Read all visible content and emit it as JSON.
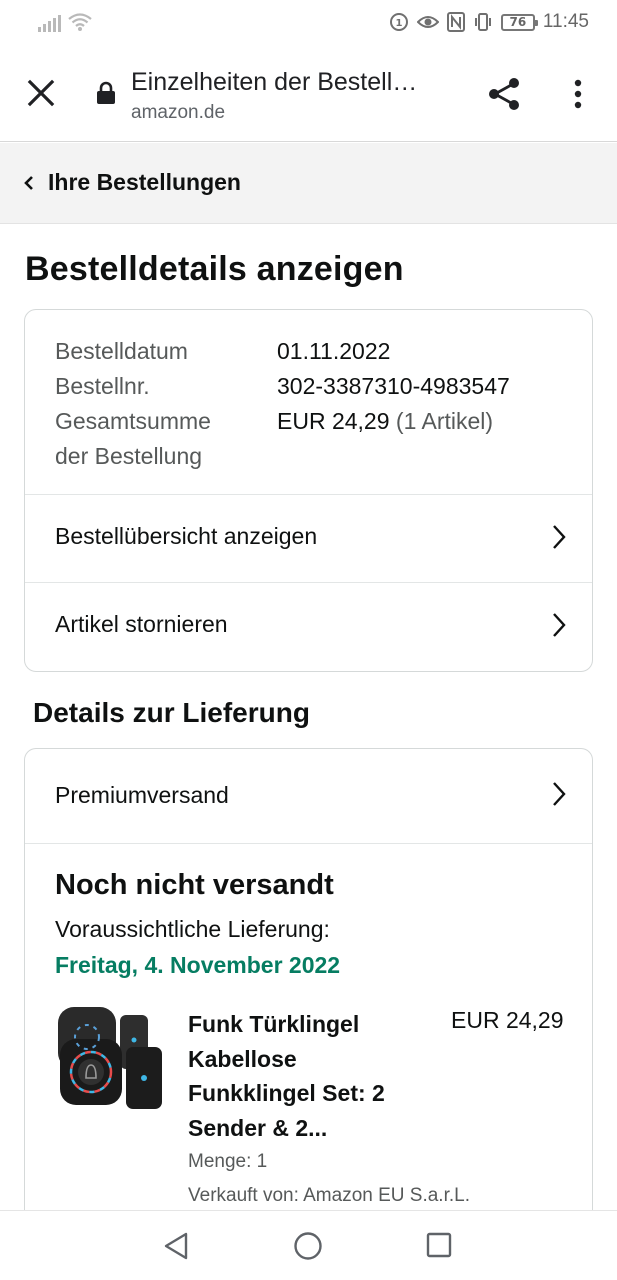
{
  "status_bar": {
    "time": "11:45",
    "battery": "76",
    "icons": [
      "signal-icon",
      "wifi-icon",
      "data-saver-icon",
      "eye-comfort-icon",
      "nfc-icon",
      "vibrate-icon",
      "battery-icon"
    ]
  },
  "browser": {
    "page_title": "Einzelheiten der Bestell…",
    "url": "amazon.de",
    "icons": [
      "close-icon",
      "lock-icon",
      "share-icon",
      "more-vert-icon"
    ]
  },
  "breadcrumb": {
    "label": "Ihre Bestellungen"
  },
  "page": {
    "heading": "Bestelldetails anzeigen"
  },
  "order": {
    "date_label": "Bestelldatum",
    "date_value": "01.11.2022",
    "number_label": "Bestellnr.",
    "number_value": "302-3387310-4983547",
    "total_label_line1": "Gesamtsumme",
    "total_label_line2": "der Bestellung",
    "total_value": "EUR 24,29",
    "total_items": "(1 Artikel)"
  },
  "actions": {
    "summary": "Bestellübersicht anzeigen",
    "cancel": "Artikel stornieren"
  },
  "delivery": {
    "section_title": "Details zur Lieferung",
    "shipping_method": "Premiumversand",
    "status": "Noch nicht versandt",
    "expected_label": "Voraussichtliche Lieferung:",
    "expected_date": "Freitag, 4. November 2022",
    "date_color": "#067d62"
  },
  "product": {
    "title": "Funk Türklingel Kabellose Funkklingel Set: 2 Sender & 2...",
    "price": "EUR 24,29",
    "quantity": "Menge: 1",
    "seller": "Verkauft von: Amazon EU S.a.r.L."
  },
  "navbar": {
    "icons": [
      "back-triangle-icon",
      "home-circle-icon",
      "recents-square-icon"
    ]
  }
}
